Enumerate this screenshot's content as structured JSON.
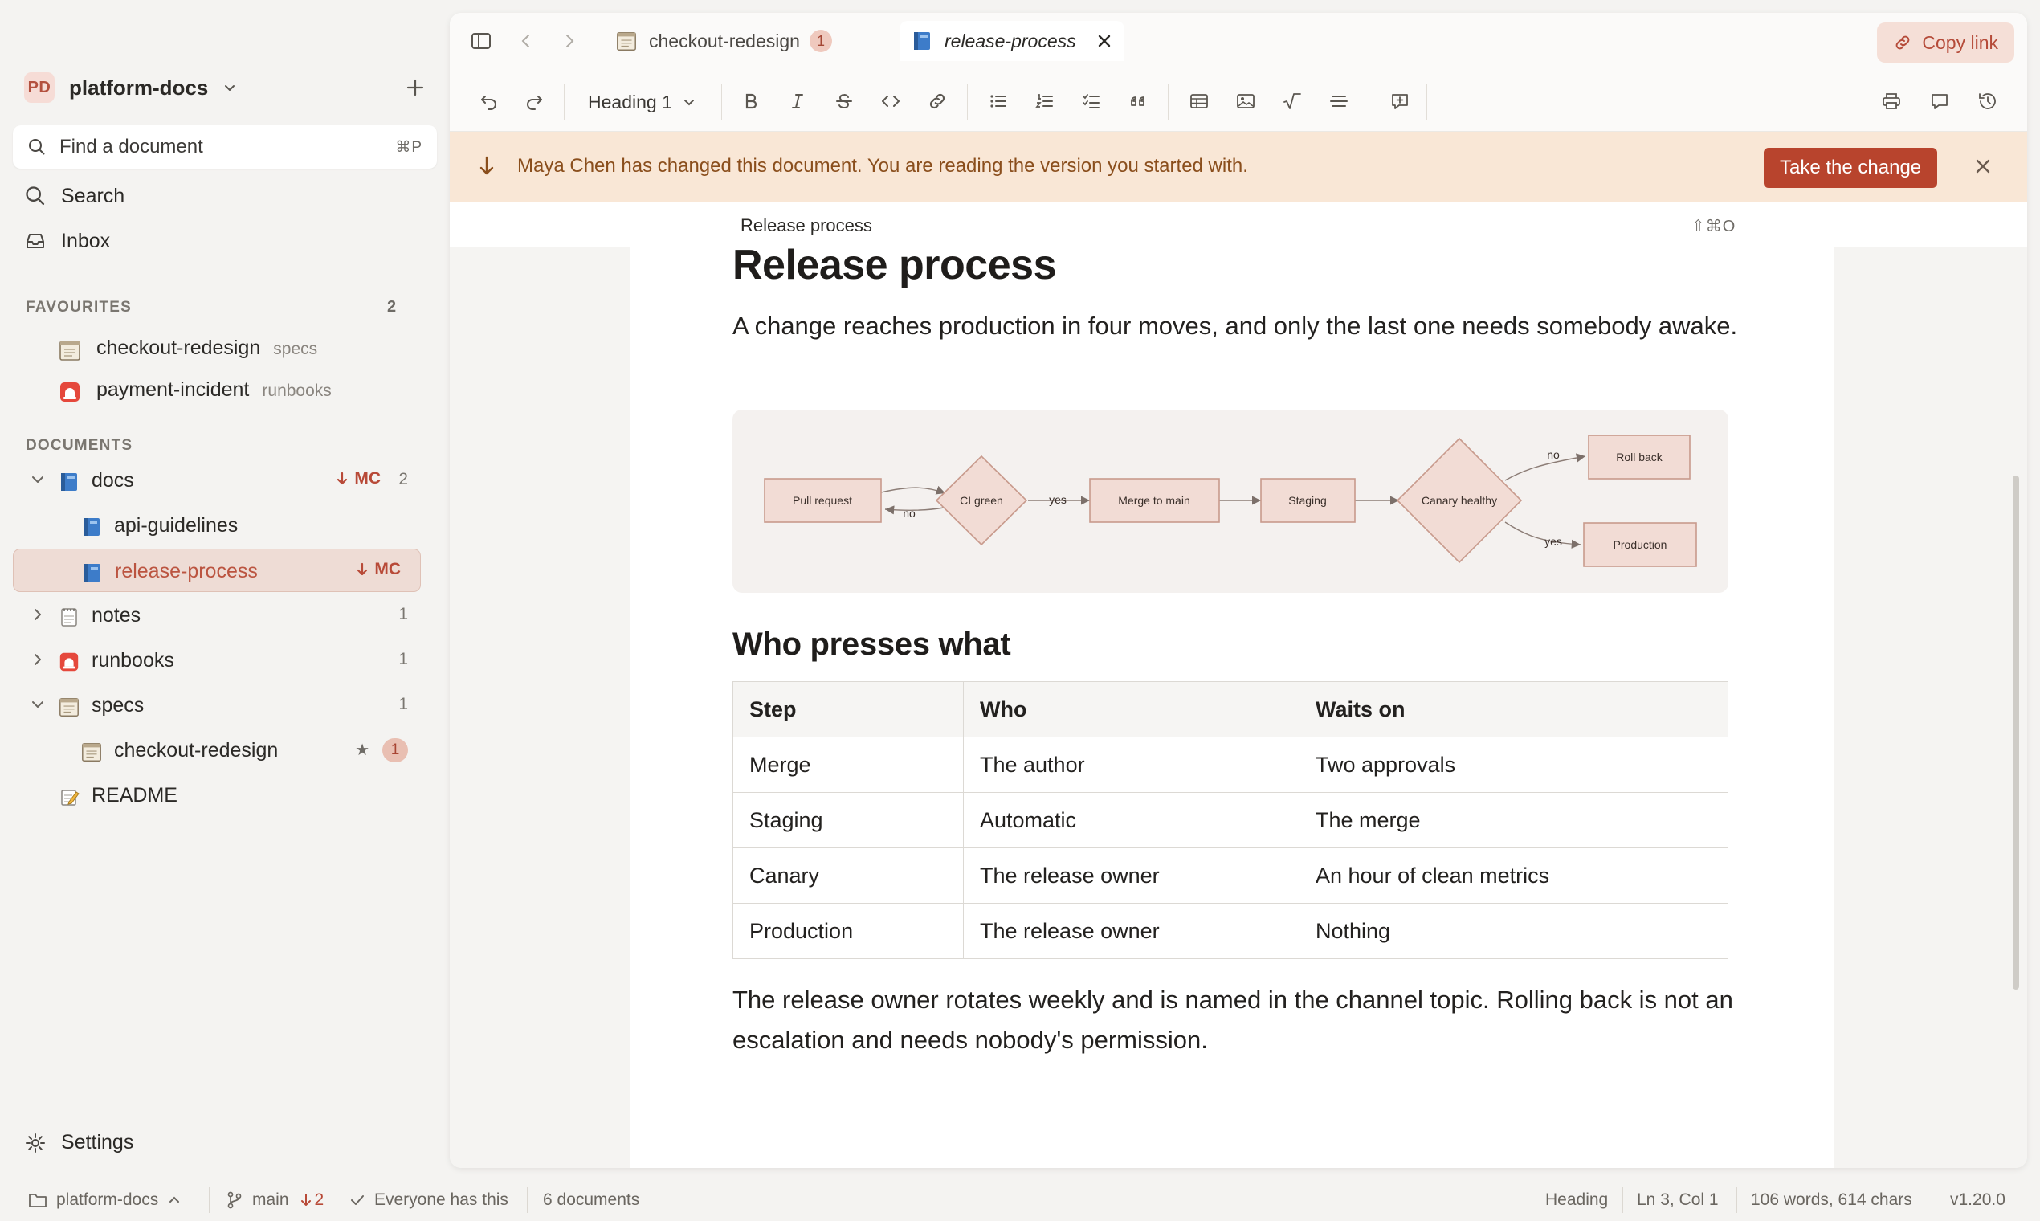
{
  "workspace": {
    "badge": "PD",
    "name": "platform-docs"
  },
  "search": {
    "placeholder": "Find a document",
    "shortcut": "⌘P"
  },
  "nav": {
    "search": "Search",
    "inbox": "Inbox"
  },
  "favourites": {
    "title": "FAVOURITES",
    "count": "2",
    "items": [
      {
        "label": "checkout-redesign",
        "folder": "specs"
      },
      {
        "label": "payment-incident",
        "folder": "runbooks"
      }
    ]
  },
  "documents": {
    "title": "DOCUMENTS",
    "tree": [
      {
        "label": "docs",
        "badge": "MC",
        "count": "2"
      },
      {
        "label": "api-guidelines"
      },
      {
        "label": "release-process",
        "badge": "MC"
      },
      {
        "label": "notes",
        "count": "1"
      },
      {
        "label": "runbooks",
        "count": "1"
      },
      {
        "label": "specs",
        "count": "1"
      },
      {
        "label": "checkout-redesign",
        "star": "★",
        "count": "1"
      },
      {
        "label": "README"
      }
    ]
  },
  "settings": "Settings",
  "statusbar": {
    "workspace": "platform-docs",
    "branch": "main",
    "behind": "2",
    "sync": "Everyone has this",
    "docs": "6 documents",
    "mode": "Heading",
    "cursor": "Ln 3, Col 1",
    "stats": "106 words, 614 chars",
    "version": "v1.20.0"
  },
  "tabs": [
    {
      "label": "checkout-redesign",
      "count": "1"
    },
    {
      "label": "release-process"
    }
  ],
  "copy_link": "Copy link",
  "toolbar": {
    "block_type": "Heading 1"
  },
  "banner": {
    "message": "Maya Chen has changed this document. You are reading the version you started with.",
    "action": "Take the change"
  },
  "breadcrumb": {
    "title": "Release process",
    "shortcut": "⇧⌘O"
  },
  "doc": {
    "title": "Release process",
    "intro": "A change reaches production in four moves, and only the last one needs somebody awake.",
    "diagram": {
      "nodes": {
        "pr": "Pull request",
        "ci": "CI green",
        "merge": "Merge to main",
        "staging": "Staging",
        "canary": "Canary healthy",
        "rollback": "Roll back",
        "production": "Production"
      },
      "edges": {
        "no1": "no",
        "yes1": "yes",
        "no2": "no",
        "yes2": "yes"
      }
    },
    "section_title": "Who presses what",
    "table": {
      "headers": [
        "Step",
        "Who",
        "Waits on"
      ],
      "rows": [
        [
          "Merge",
          "The author",
          "Two approvals"
        ],
        [
          "Staging",
          "Automatic",
          "The merge"
        ],
        [
          "Canary",
          "The release owner",
          "An hour of clean metrics"
        ],
        [
          "Production",
          "The release owner",
          "Nothing"
        ]
      ]
    },
    "outro": "The release owner rotates weekly and is named in the channel topic. Rolling back is not an escalation and needs nobody's permission."
  },
  "colors": {
    "accent": "#b8442d",
    "banner_bg": "#f9e7d6",
    "active_item_bg": "#eedcd5"
  }
}
